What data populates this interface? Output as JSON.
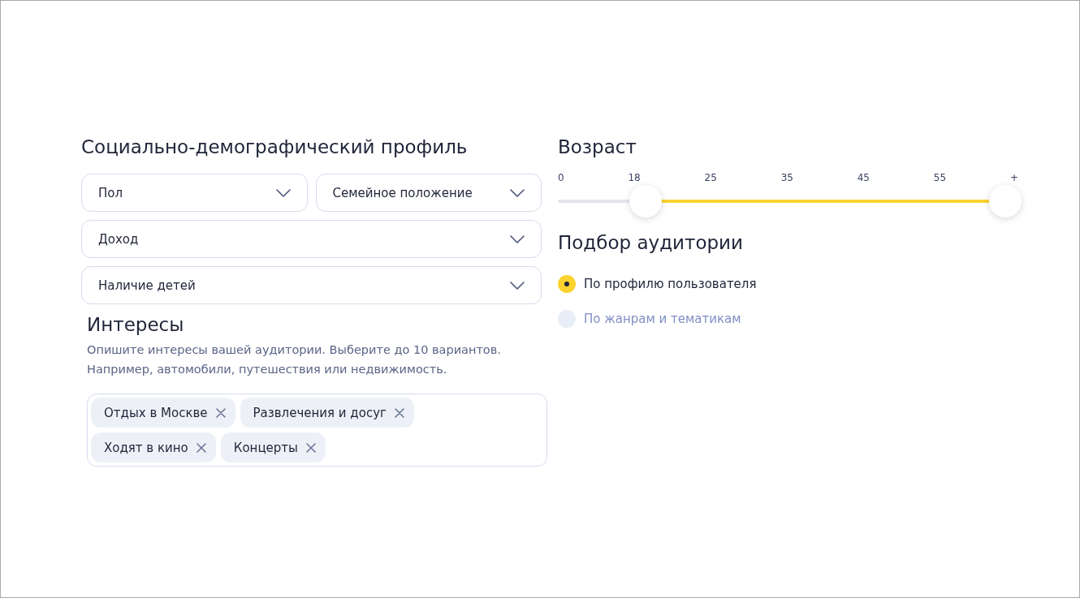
{
  "profile": {
    "title": "Социально-демографический профиль",
    "dropdowns": [
      [
        {
          "label": "Пол"
        },
        {
          "label": "Семейное положение"
        }
      ],
      [
        {
          "label": "Доход"
        }
      ],
      [
        {
          "label": "Наличие детей"
        }
      ]
    ]
  },
  "interests": {
    "title": "Интересы",
    "description": "Опишите интересы вашей аудитории. Выберите до 10 вариантов. Например, автомобили, путешествия или недвижимость.",
    "tags": [
      {
        "label": "Отдых в Москве"
      },
      {
        "label": "Развлечения и досуг"
      },
      {
        "label": "Ходят в кино"
      },
      {
        "label": "Концерты"
      }
    ]
  },
  "age": {
    "title": "Возраст",
    "ticks": [
      "0",
      "18",
      "25",
      "35",
      "45",
      "55",
      "+"
    ],
    "thumbs": [
      {
        "level": 0.19
      },
      {
        "level": 0.972
      }
    ]
  },
  "audience": {
    "title": "Подбор аудитории",
    "options": [
      {
        "label": "По профилю пользователя",
        "selected": true
      },
      {
        "label": "По жанрам и тематикам",
        "selected": false
      }
    ]
  }
}
